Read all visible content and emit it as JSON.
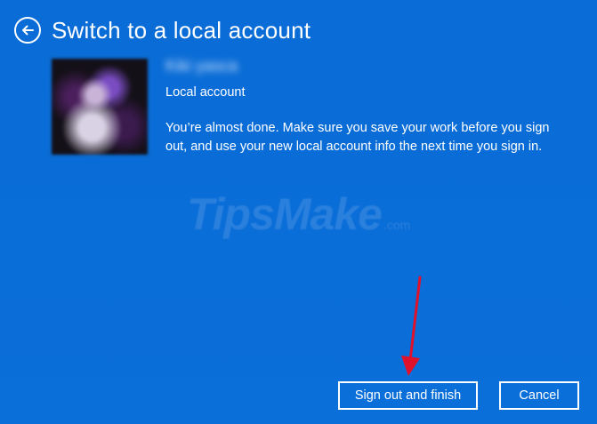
{
  "header": {
    "back_icon": "back-arrow-circle-icon",
    "title": "Switch to a local account"
  },
  "account": {
    "username": "Kiki yasca",
    "type_label": "Local account",
    "message": "You’re almost done. Make sure you save your work before you sign out, and use your new local account info the next time you sign in."
  },
  "watermark": {
    "text": "TipsMake",
    "suffix": ".com"
  },
  "buttons": {
    "primary_label": "Sign out and finish",
    "cancel_label": "Cancel"
  },
  "colors": {
    "background": "#0b6fd9",
    "text": "#ffffff",
    "annotation_arrow": "#e0112a"
  }
}
